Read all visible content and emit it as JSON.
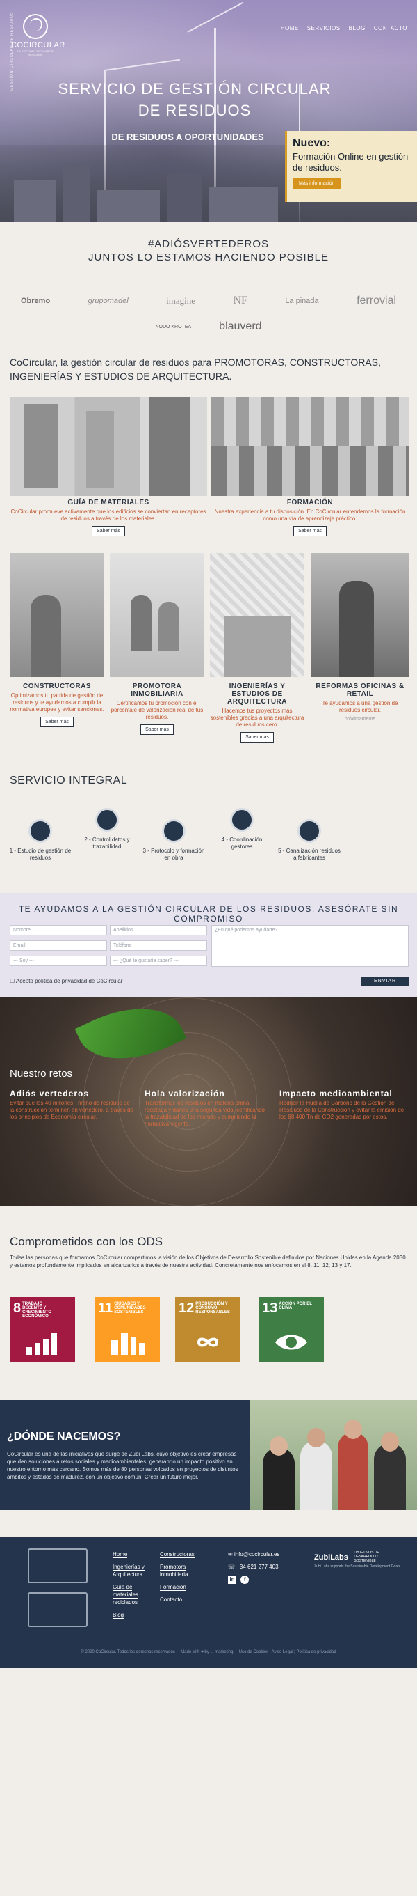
{
  "header": {
    "logo_name": "COCIRCULAR",
    "logo_sub": "LA GESTIÓN CIRCULAR DE RESIDUOS",
    "nav": [
      "HOME",
      "SERVICIOS",
      "BLOG",
      "CONTACTO"
    ],
    "side_text": "GESTIÓN CIRCULAR DE RESIDUOS",
    "title": "SERVICIO DE GESTIÓN CIRCULAR DE RESIDUOS",
    "tagline": "DE RESIDUOS A OPORTUNIDADES",
    "promo": {
      "title": "Nuevo:",
      "text": "Formación Online en gestión de residuos.",
      "button": "Más información"
    }
  },
  "clients": {
    "title_line1": "#ADIÓSVERTEDEROS",
    "title_line2": "JUNTOS LO ESTAMOS HACIENDO POSIBLE",
    "logos": [
      "Obremo",
      "grupomadel",
      "imagine",
      "NF",
      "La pinada",
      "ferrovial",
      "NODO KROTEA",
      "blauverd"
    ]
  },
  "intro": "CoCircular, la gestión circular de residuos para PROMOTORAS, CONSTRUCTORAS, INGENIERÍAS Y ESTUDIOS DE ARQUITECTURA.",
  "cards_top": [
    {
      "title": "GUÍA DE MATERIALES",
      "text": "CoCircular promueve activamente que los edificios se conviertan en receptores de residuos a través de los materiales.",
      "button": "Saber más"
    },
    {
      "title": "FORMACIÓN",
      "text": "Nuestra experiencia a tu disposición. En CoCircular entendemos la formación como una vía de aprendizaje práctico.",
      "button": "Saber más"
    }
  ],
  "cards_bottom": [
    {
      "title": "CONSTRUCTORAS",
      "text": "Optimizamos tu partida de gestión de residuos y te ayudamos a cumplir la normativa europea y evitar sanciones.",
      "button": "Saber más"
    },
    {
      "title": "PROMOTORA INMOBILIARIA",
      "text": "Certificamos tu promoción con el porcentaje de valorización real de tus residuos.",
      "button": "Saber más"
    },
    {
      "title": "INGENIERÍAS Y ESTUDIOS DE ARQUITECTURA",
      "text": "Hacemos tus proyectos más sostenibles gracias a una arquitectura de residuos cero.",
      "button": "Saber más"
    },
    {
      "title": "REFORMAS OFICINAS & RETAIL",
      "text": "Te ayudamos a una gestión de residuos circular.",
      "button": "próximamente"
    }
  ],
  "servicio": {
    "title": "SERVICIO INTEGRAL",
    "steps": [
      "1 - Estudio de gestión de residuos",
      "2 - Control datos y trazabilidad",
      "3 - Protocolo y formación en obra",
      "4 - Coordinación gestores",
      "5 - Canalización residuos a fabricantes"
    ]
  },
  "form": {
    "title": "TE AYUDAMOS A LA GESTIÓN CIRCULAR DE LOS RESIDUOS. ASESÓRATE SIN COMPROMISO",
    "fields": {
      "nombre": "Nombre",
      "apellidos": "Apellidos",
      "email": "Email",
      "telefono": "Teléfono",
      "soy": "--- Soy ---",
      "saber": "--- ¿Qué te gustaría saber? ---",
      "mensaje": "¿En qué podemos ayudarte?"
    },
    "privacy": "Acepto política de privacidad de CoCircular",
    "submit": "ENVIAR"
  },
  "retos": {
    "title": "Nuestro retos",
    "items": [
      {
        "title": "Adiós vertederos",
        "text": "Evitar que los 40 millones Tn/año de residuos de la construcción terminen en vertedero, a través de los principios de Economía circular."
      },
      {
        "title": "Hola valorización",
        "text": "Transformar los residuos en materia prima reciclada y darles una segunda vida, certificando la trazabilidad de los mismos y cumpliendo la normativa vigente."
      },
      {
        "title": "Impacto medioambiental",
        "text": "Reducir la Huella de Carbono de la Gestión de Residuos de la Construcción y evitar la emisión de los 88.400 Tn de CO2 generadas por estos."
      }
    ]
  },
  "ods": {
    "title": "Comprometidos con los ODS",
    "text": "Todas las personas que formamos CoCircular compartimos la visión de los Objetivos de Desarrollo Sostenible definidos por Naciones Unidas en la Agenda 2030 y estamos profundamente implicados en alcanzarlos a través de nuestra actividad. Concretamente nos enfocamos en el 8, 11, 12, 13 y 17.",
    "goals": [
      {
        "num": "8",
        "label": "TRABAJO DECENTE Y CRECIMIENTO ECONÓMICO",
        "color": "#a21942"
      },
      {
        "num": "11",
        "label": "CIUDADES Y COMUNIDADES SOSTENIBLES",
        "color": "#fd9d24"
      },
      {
        "num": "12",
        "label": "PRODUCCIÓN Y CONSUMO RESPONSABLES",
        "color": "#bf8b2e"
      },
      {
        "num": "13",
        "label": "ACCIÓN POR EL CLIMA",
        "color": "#3f7e44"
      }
    ]
  },
  "donde": {
    "title": "¿DÓNDE NACEMOS?",
    "text": "CoCircular es una de las iniciativas que surge de Zubi Labs, cuyo objetivo es crear empresas que den soluciones a retos sociales y medioambientales, generando un impacto positivo en nuestro entorno más cercano. Somos más de 80 personas volcados en proyectos de distintos ámbitos y estados de madurez, con un objetivo común: Crear un futuro mejor."
  },
  "footer": {
    "col1": [
      "Home",
      "Ingenierías y Arquitectura",
      "Guía de materiales reciclados",
      "Blog"
    ],
    "col2": [
      "Constructoras",
      "Promotora inmobiliaria",
      "Formación",
      "Contacto"
    ],
    "email": "info@cocircular.es",
    "phone": "+34 621 277 403",
    "zubi": "ZubiLabs",
    "zubi_ods": "OBJETIVOS DE DESARROLLO SOSTENIBLE",
    "zubi_sub": "Zubi Labs supports the Sustainable Development Goals",
    "copyright": "© 2020 CoCircular. Todos los derechos reservados",
    "made": "Made with ♥ by ... marketing",
    "legal": "Uso de Cookies | Aviso Legal | Política de privacidad"
  }
}
